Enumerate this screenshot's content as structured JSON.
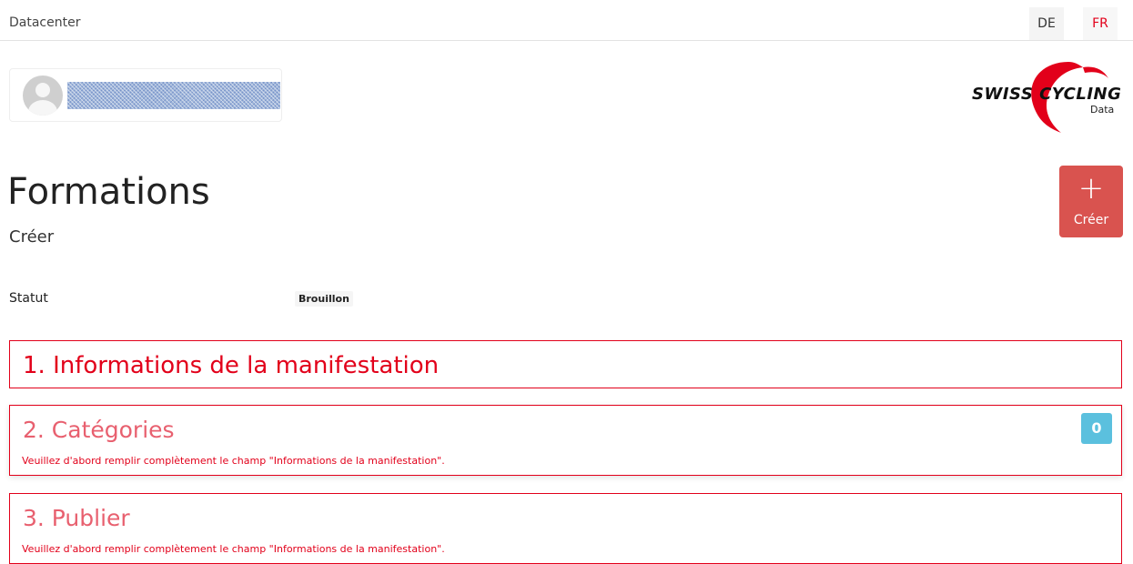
{
  "header": {
    "brand": "Datacenter",
    "languages": [
      {
        "code": "DE",
        "active": false
      },
      {
        "code": "FR",
        "active": true
      }
    ]
  },
  "logo": {
    "text": "SWISS CYCLING",
    "subtitle": "Data",
    "accent_color": "#e2001a"
  },
  "page": {
    "title": "Formations",
    "subtitle": "Créer"
  },
  "actions": {
    "create_label": "Créer",
    "create_icon": "plus-icon",
    "create_color": "#d9534f"
  },
  "status": {
    "label": "Statut",
    "value": "Brouillon"
  },
  "sections": [
    {
      "title": "1. Informations de la manifestation",
      "note": null,
      "count": null
    },
    {
      "title": "2. Catégories",
      "note": "Veuillez d'abord remplir complètement le champ \"Informations de la manifestation\".",
      "count": "0"
    },
    {
      "title": "3. Publier",
      "note": "Veuillez d'abord remplir complètement le champ \"Informations de la manifestation\".",
      "count": null
    }
  ],
  "colors": {
    "section_border": "#e2001a",
    "section_title_disabled": "#e8606f",
    "count_badge": "#5bc0de"
  }
}
